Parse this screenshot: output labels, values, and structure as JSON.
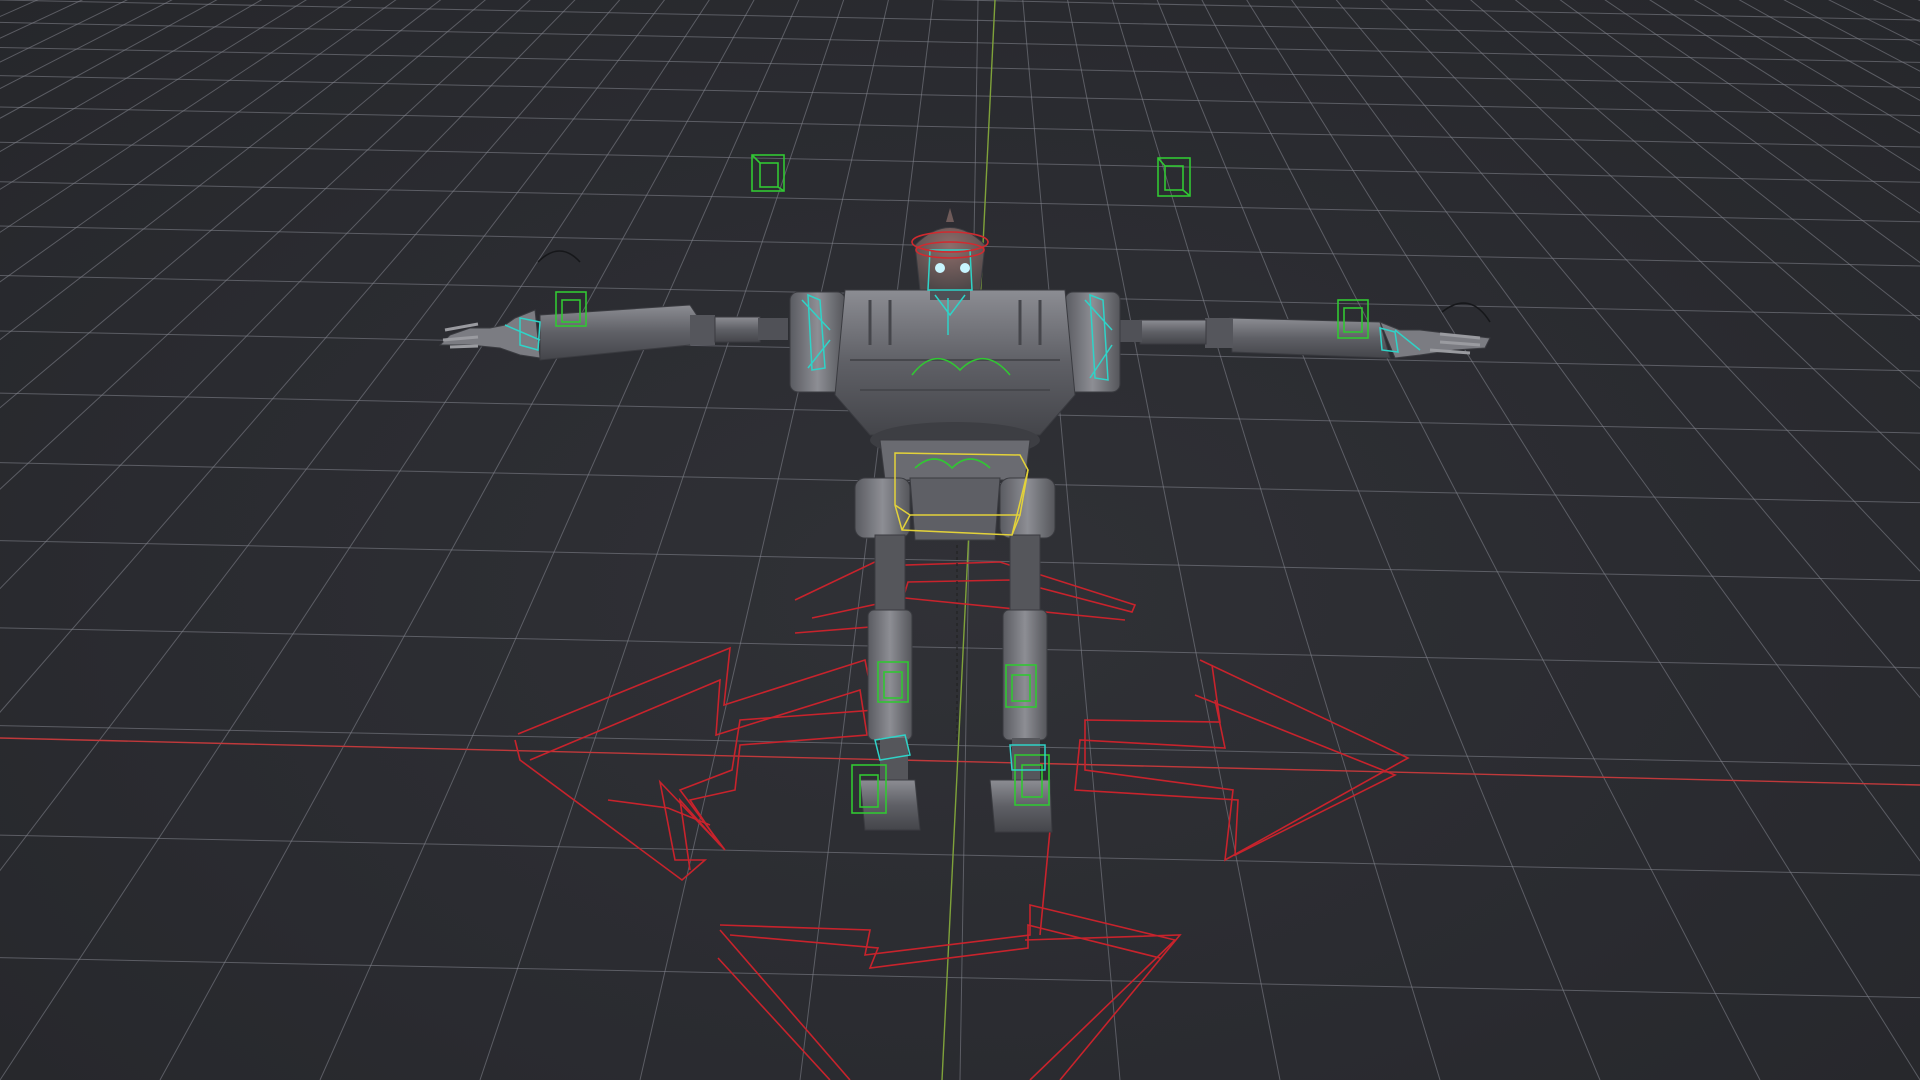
{
  "viewport": {
    "background": "#2b2c31",
    "grid_color": "#8a8c92",
    "x_axis_color": "#c0393b",
    "y_axis_color": "#7fa23a"
  },
  "scene": {
    "model": "robot-character-t-pose",
    "rig_colors": {
      "fk_controls": "#2fd3c8",
      "ik_controls": "#31c733",
      "root_controls": "#c8232c",
      "selected_control": "#e3d23a",
      "head_control": "#d12a2f"
    }
  }
}
